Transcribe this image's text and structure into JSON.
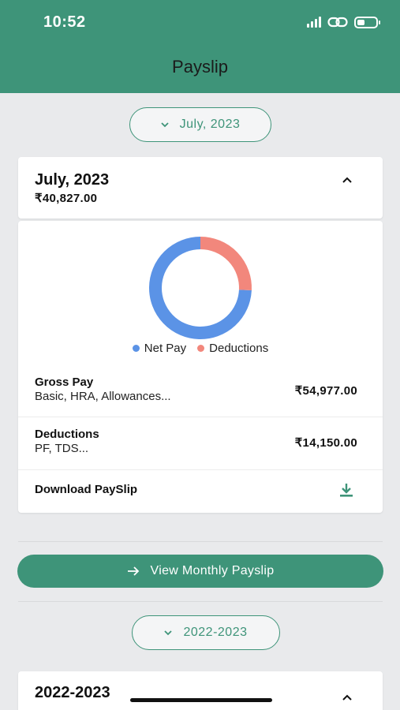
{
  "status_bar": {
    "time": "10:52"
  },
  "header": {
    "title": "Payslip"
  },
  "month_filter": {
    "label": "July, 2023"
  },
  "month_card": {
    "title": "July, 2023",
    "amount": "₹40,827.00"
  },
  "chart_data": {
    "type": "pie",
    "series": [
      {
        "name": "Net Pay",
        "value": 40827.0,
        "color": "#5b93e6"
      },
      {
        "name": "Deductions",
        "value": 14150.0,
        "color": "#f2877c"
      }
    ]
  },
  "details": {
    "gross_pay": {
      "label": "Gross Pay",
      "sub": "Basic, HRA, Allowances...",
      "value": "₹54,977.00"
    },
    "deductions": {
      "label": "Deductions",
      "sub": "PF, TDS...",
      "value": "₹14,150.00"
    },
    "download": {
      "label": "Download PaySlip",
      "icon": "download-icon"
    }
  },
  "view_button": {
    "label": "View Monthly Payslip",
    "icon": "arrow-right-icon"
  },
  "year_filter": {
    "label": "2022-2023"
  },
  "year_card": {
    "title": "2022-2023"
  }
}
